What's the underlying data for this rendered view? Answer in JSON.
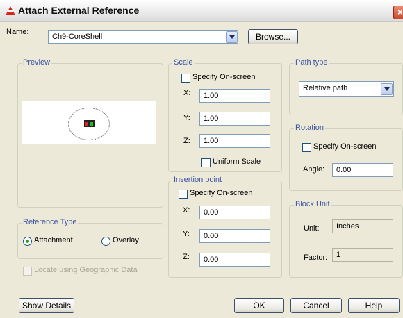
{
  "window": {
    "title": "Attach External Reference",
    "close_glyph": "×"
  },
  "name_row": {
    "label": "Name:",
    "value": "Ch9-CoreShell",
    "browse": "Browse..."
  },
  "preview": {
    "title": "Preview"
  },
  "reference_type": {
    "title": "Reference Type",
    "attachment": "Attachment",
    "overlay": "Overlay",
    "selected": "Attachment"
  },
  "geo": {
    "label": "Locate using Geographic Data",
    "checked": false,
    "enabled": false
  },
  "scale": {
    "title": "Scale",
    "specify": "Specify On-screen",
    "x_label": "X:",
    "x": "1.00",
    "y_label": "Y:",
    "y": "1.00",
    "z_label": "Z:",
    "z": "1.00",
    "uniform": "Uniform Scale"
  },
  "insertion": {
    "title": "Insertion point",
    "specify": "Specify On-screen",
    "x_label": "X:",
    "x": "0.00",
    "y_label": "Y:",
    "y": "0.00",
    "z_label": "Z:",
    "z": "0.00"
  },
  "path_type": {
    "title": "Path type",
    "value": "Relative path"
  },
  "rotation": {
    "title": "Rotation",
    "specify": "Specify On-screen",
    "angle_label": "Angle:",
    "angle": "0.00"
  },
  "block_unit": {
    "title": "Block Unit",
    "unit_label": "Unit:",
    "unit": "Inches",
    "factor_label": "Factor:",
    "factor": "1"
  },
  "buttons": {
    "show_details": "Show Details",
    "ok": "OK",
    "cancel": "Cancel",
    "help": "Help"
  },
  "icons": [
    "app-icon",
    "close-icon",
    "dropdown-arrow-icon",
    "xref-preview-icon"
  ]
}
